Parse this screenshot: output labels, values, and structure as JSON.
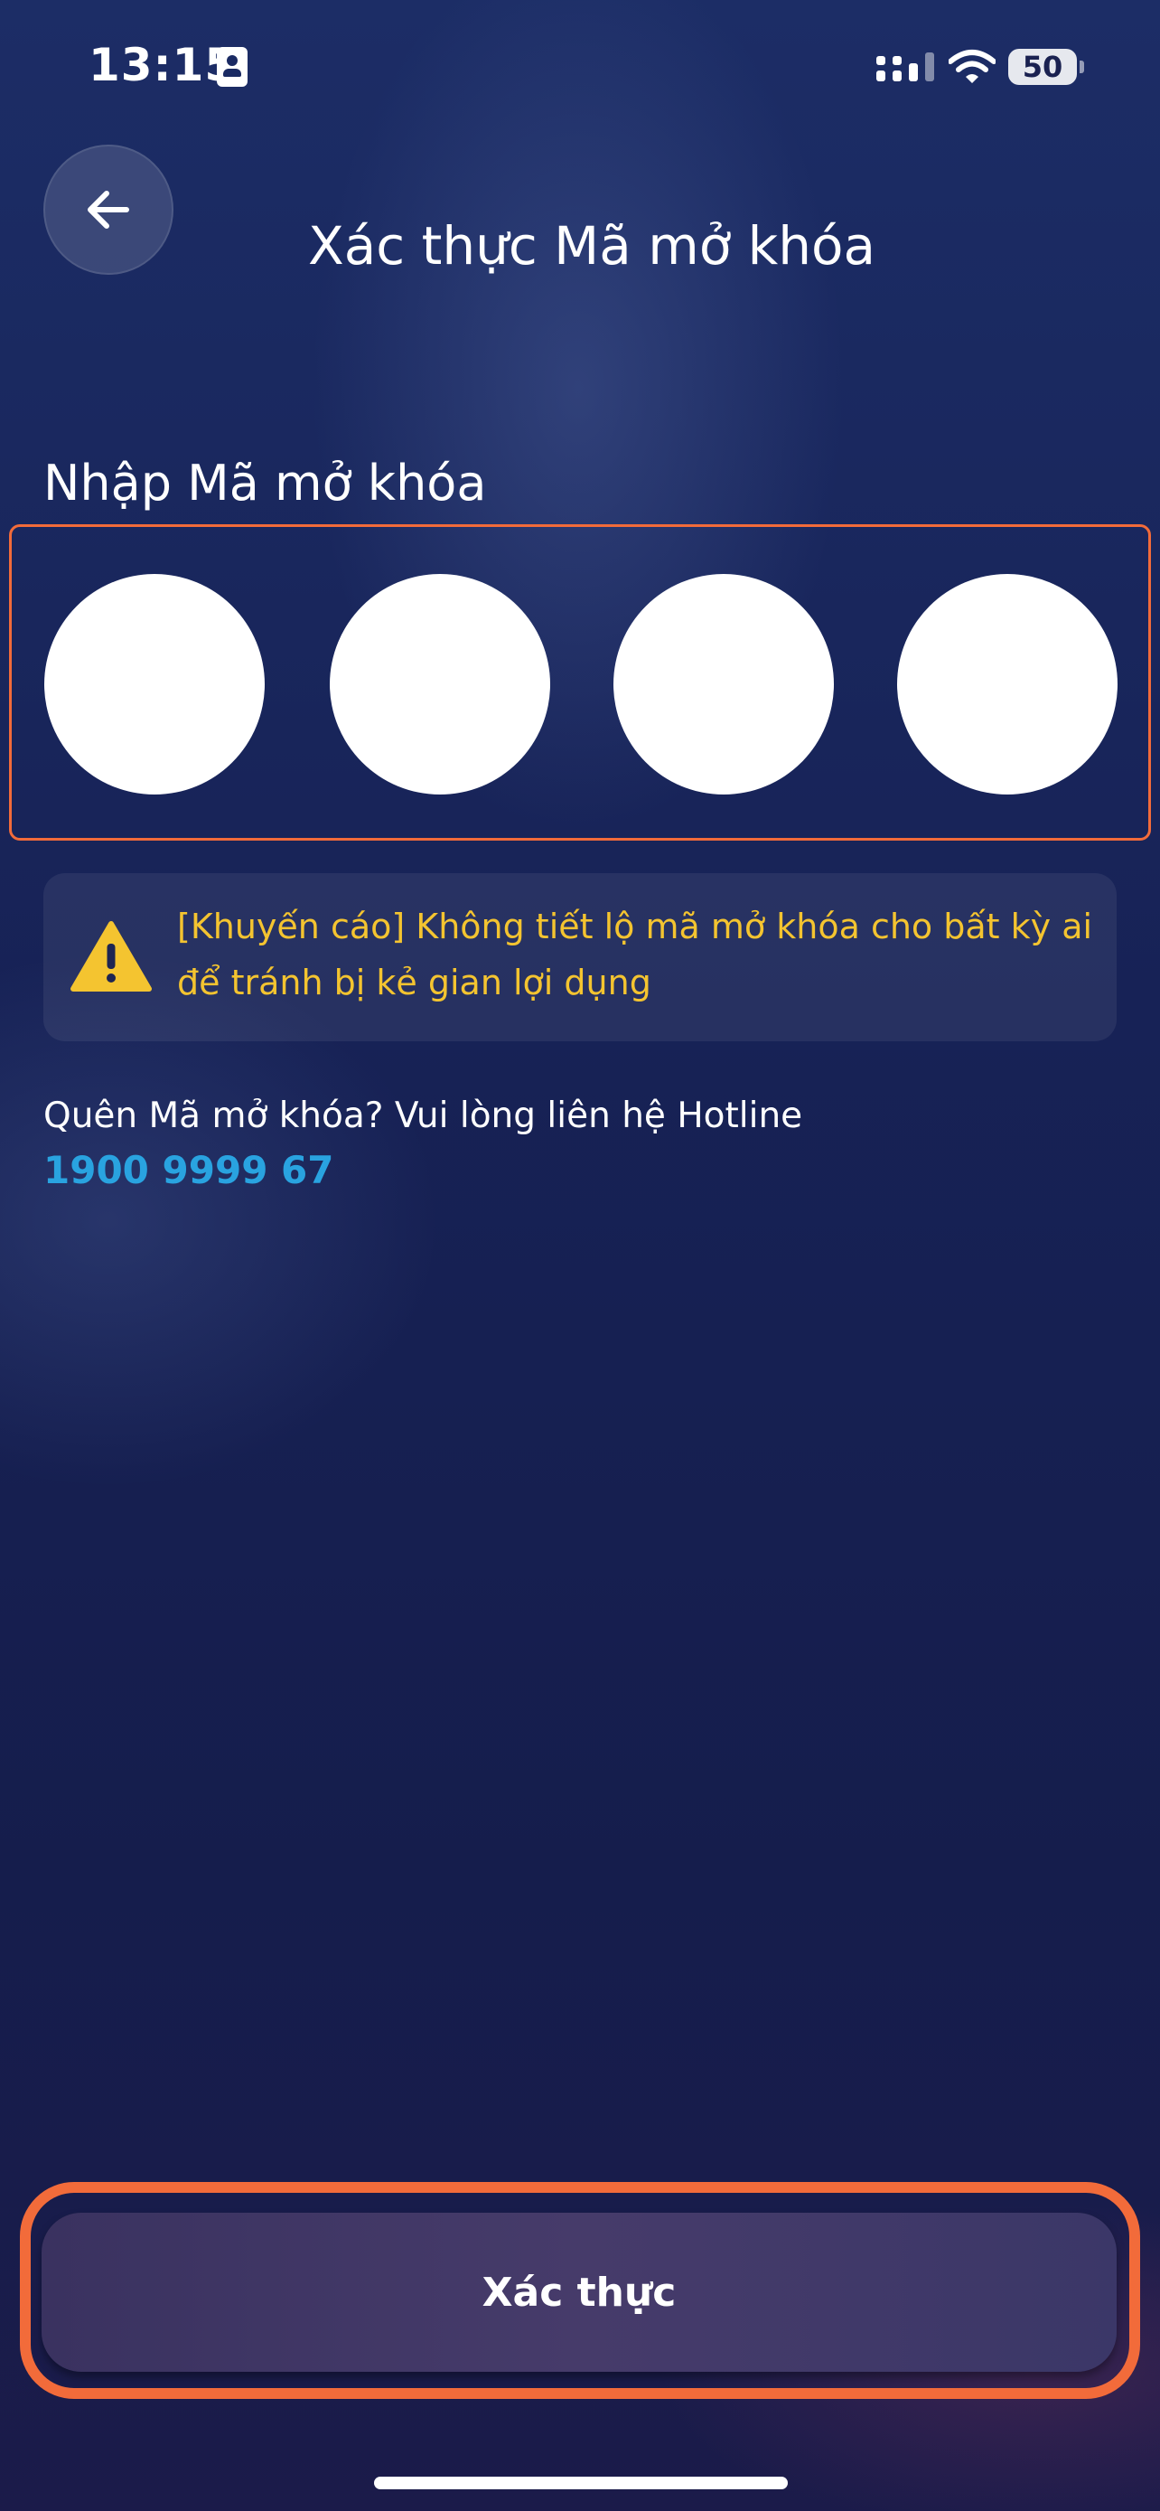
{
  "status_bar": {
    "time": "13:15",
    "battery": "50",
    "icons": [
      "contact-card-icon",
      "signal-icon",
      "wifi-icon",
      "battery-icon"
    ]
  },
  "header": {
    "title": "Xác thực Mã mở khóa",
    "back_icon": "arrow-left-icon"
  },
  "pin": {
    "label": "Nhập Mã mở khóa",
    "length": 4
  },
  "warning": {
    "icon": "warning-triangle-icon",
    "text": "[Khuyến cáo] Không tiết lộ mã mở khóa cho bất kỳ ai để tránh bị kẻ gian lợi dụng"
  },
  "hotline": {
    "text": "Quên Mã mở khóa? Vui lòng liên hệ Hotline",
    "number": "1900 9999 67"
  },
  "submit": {
    "label": "Xác thực"
  },
  "colors": {
    "accent_orange": "#f26b3a",
    "warning_yellow": "#f4c430",
    "link_blue": "#29a3e0"
  }
}
